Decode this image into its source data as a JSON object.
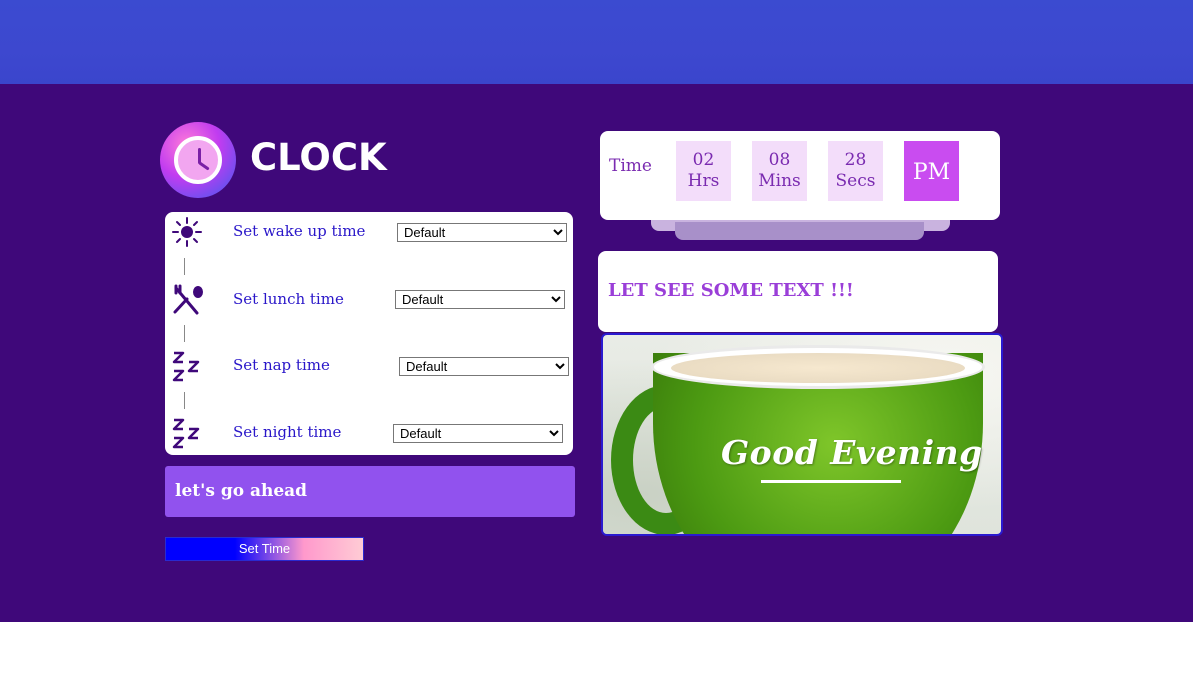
{
  "brand": {
    "logo_text": "CLOCK",
    "logo_icon": "clock-icon"
  },
  "schedule": {
    "items": [
      {
        "icon": "sun-icon",
        "label": "Set wake up time",
        "selected": "Default"
      },
      {
        "icon": "fork-spoon-icon",
        "label": "Set lunch time",
        "selected": "Default"
      },
      {
        "icon": "zzz-icon",
        "label": "Set nap time",
        "selected": "Default"
      },
      {
        "icon": "zzz-icon",
        "label": "Set night time",
        "selected": "Default"
      }
    ]
  },
  "banner": {
    "text": "let's go ahead"
  },
  "actions": {
    "set_time_label": "Set Time"
  },
  "clock": {
    "label": "Time",
    "hours": "02",
    "hours_unit": "Hrs",
    "minutes": "08",
    "minutes_unit": "Mins",
    "seconds": "28",
    "seconds_unit": "Secs",
    "ampm": "PM"
  },
  "message": {
    "text": "LET SEE SOME TEXT !!!"
  },
  "image": {
    "caption": "Good Evening"
  },
  "colors": {
    "top_band": "#3b4bd0",
    "background": "#3f087a",
    "accent_purple": "#9152ee",
    "ampm_bg": "#c94cf0",
    "label_blue": "#2a17c9"
  }
}
